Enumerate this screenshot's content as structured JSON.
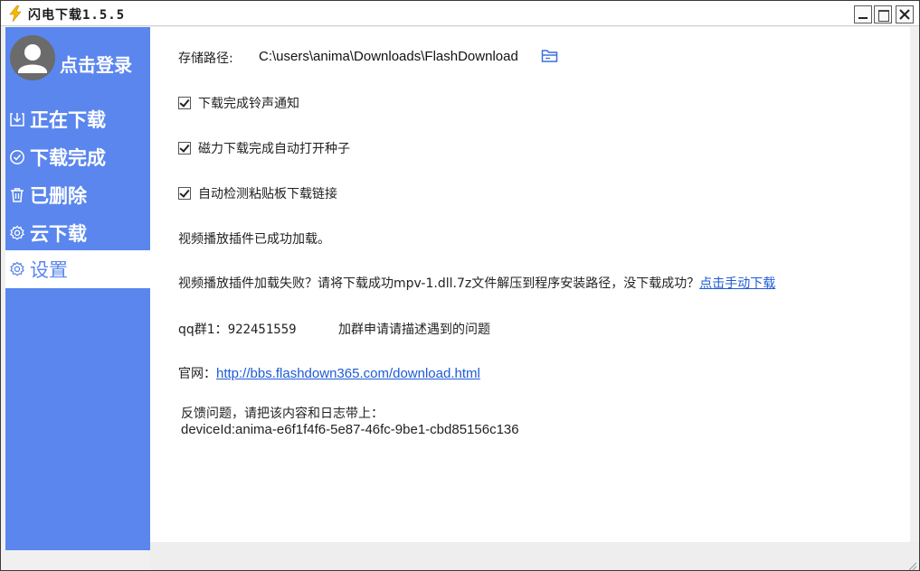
{
  "window": {
    "title": "闪电下载1.5.5",
    "accent": "#5a86ee"
  },
  "sidebar": {
    "login_label": "点击登录",
    "items": [
      {
        "label": "正在下载",
        "icon": "download-icon"
      },
      {
        "label": "下载完成",
        "icon": "check-circle-icon"
      },
      {
        "label": "已删除",
        "icon": "trash-icon"
      },
      {
        "label": "云下载",
        "icon": "gear-icon"
      },
      {
        "label": "设置",
        "icon": "gear-icon",
        "active": true
      }
    ]
  },
  "settings": {
    "storage_label": "存储路径:",
    "storage_path": "C:\\users\\anima\\Downloads\\FlashDownload",
    "checkboxes": [
      {
        "label": "下载完成铃声通知",
        "checked": true
      },
      {
        "label": "磁力下载完成自动打开种子",
        "checked": true
      },
      {
        "label": "自动检测粘贴板下载链接",
        "checked": true
      }
    ],
    "plugin_ok": "视频播放插件已成功加载。",
    "plugin_fail_text": "视频播放插件加载失败？请将下载成功mpv-1.dll.7z文件解压到程序安装路径，没下载成功？",
    "plugin_fail_link": "点击手动下载",
    "qq_label": "qq群1：",
    "qq_number": "922451559",
    "qq_note": "加群申请请描述遇到的问题",
    "website_label": "官网：",
    "website_url": "http://bbs.flashdown365.com/download.html",
    "feedback_text": "反馈问题，请把该内容和日志带上：",
    "device_id": "deviceId:anima-e6f1f4f6-5e87-46fc-9be1-cbd85156c136"
  }
}
